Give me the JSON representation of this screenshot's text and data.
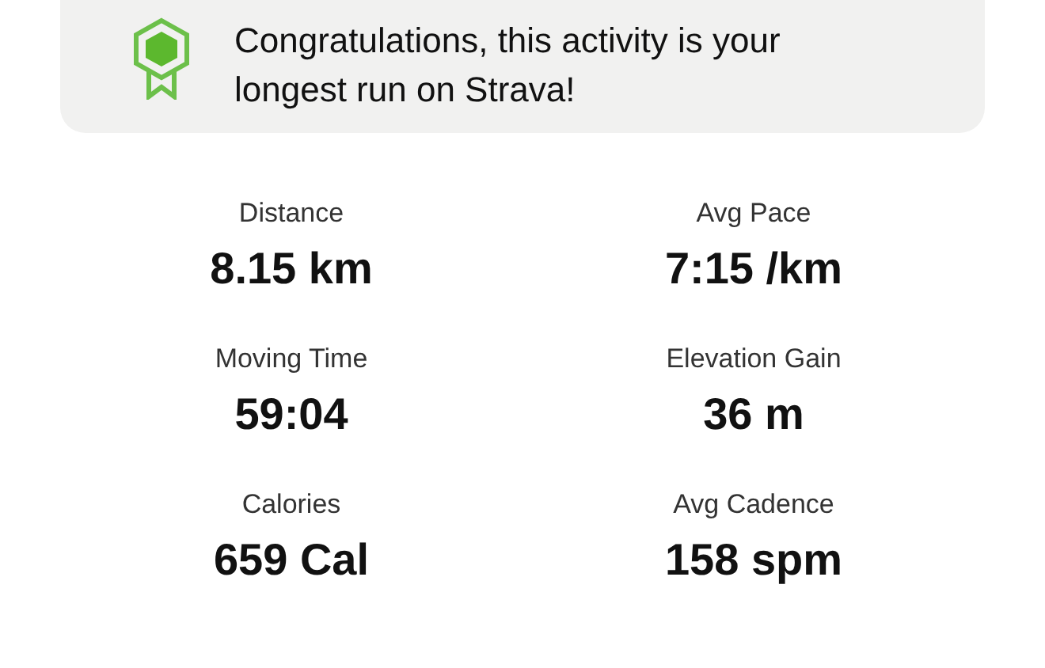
{
  "achievement": {
    "message": "Congratulations, this activity is your longest run on Strava!"
  },
  "stats": [
    {
      "label": "Distance",
      "value": "8.15 km"
    },
    {
      "label": "Avg Pace",
      "value": "7:15 /km"
    },
    {
      "label": "Moving Time",
      "value": "59:04"
    },
    {
      "label": "Elevation Gain",
      "value": "36 m"
    },
    {
      "label": "Calories",
      "value": "659 Cal"
    },
    {
      "label": "Avg Cadence",
      "value": "158 spm"
    }
  ]
}
